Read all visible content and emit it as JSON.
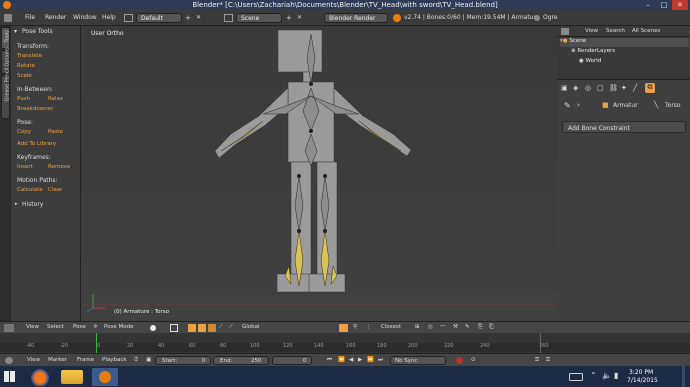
{
  "window": {
    "title": "Blender* [C:\\Users\\Zachariah\\Documents\\Blender\\TV_Head\\with sword\\TV_Head.blend]",
    "minimize": "–",
    "maximize": "□",
    "close": "✕"
  },
  "menubar": {
    "items": [
      "File",
      "Render",
      "Window",
      "Help"
    ],
    "layout": "Default",
    "scene": "Scene",
    "engine": "Blender Render",
    "stats": "v2.74 | Bones:0/60 | Mem:19.54M | Armature",
    "ogre": "Ogre"
  },
  "side_tabs": [
    "Tools",
    "Options",
    "Grease Pencil"
  ],
  "toolshelf": {
    "panel_title": "Pose Tools",
    "transform_label": "Transform:",
    "translate": "Translate",
    "rotate": "Rotate",
    "scale": "Scale",
    "inbetween_label": "In-Between:",
    "push": "Push",
    "relax": "Relax",
    "breakdowner": "Breakdowner",
    "pose_label": "Pose:",
    "copy": "Copy",
    "paste": "Paste",
    "add_library": "Add To Library",
    "keyframes_label": "Keyframes:",
    "insert": "Insert",
    "remove": "Remove",
    "motion_label": "Motion Paths:",
    "calculate": "Calculate",
    "clear": "Clear",
    "history": "History"
  },
  "viewport": {
    "view_label": "User Ortho",
    "object_label": "(0) Armature : Torso"
  },
  "outliner": {
    "view": "View",
    "search": "Search",
    "all_scenes": "All Scenes",
    "scene": "Scene",
    "render_layers": "RenderLayers",
    "world": "World"
  },
  "properties": {
    "armature": "Armatur",
    "torso": "Torso",
    "add_constraint": "Add Bone Constraint"
  },
  "view3d_header": {
    "view": "View",
    "select": "Select",
    "pose": "Pose",
    "mode": "Pose Mode",
    "orientation": "Global",
    "snap": "Closest"
  },
  "timeline": {
    "ticks": [
      "-40",
      "-20",
      "0",
      "20",
      "40",
      "60",
      "80",
      "100",
      "120",
      "140",
      "160",
      "180",
      "200",
      "220",
      "240",
      "260"
    ],
    "view": "View",
    "marker": "Marker",
    "frame": "Frame",
    "playback": "Playback",
    "start_label": "Start:",
    "start": "0",
    "end_label": "End:",
    "end": "250",
    "current": "0",
    "sync": "No Sync"
  },
  "taskbar": {
    "time": "3:20 PM",
    "date": "7/14/2015"
  },
  "colors": {
    "accent": "#f0a040",
    "title_bar": "#2d3b57",
    "taskbar": "#1c2a44",
    "bone_selected": "#d8c25a"
  }
}
